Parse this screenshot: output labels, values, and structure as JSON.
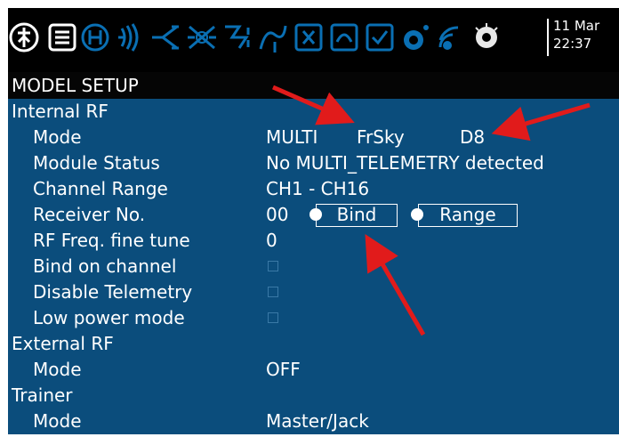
{
  "status_bar": {
    "icons": [
      "radio-menu-icon",
      "model-menu-icon",
      "heli-icon",
      "flight-modes-icon",
      "inputs-icon",
      "mixer-icon",
      "outputs-icon",
      "curves-icon",
      "gvars-icon",
      "logical-switches-icon",
      "special-functions-icon",
      "custom-scripts-icon",
      "telemetry-icon",
      "display-icon"
    ],
    "date": "11 Mar",
    "time": "22:37"
  },
  "page_title": "MODEL SETUP",
  "internal_rf": {
    "section_label": "Internal RF",
    "mode_label": "Mode",
    "mode_value": "MULTI",
    "protocol": "FrSky",
    "subtype": "D8",
    "module_status_label": "Module Status",
    "module_status_value": "No MULTI_TELEMETRY detected",
    "channel_range_label": "Channel Range",
    "channel_range_value": "CH1 - CH16",
    "receiver_no_label": "Receiver No.",
    "receiver_no_value": "00",
    "bind_label": "Bind",
    "range_label": "Range",
    "rf_freq_label": "RF Freq. fine tune",
    "rf_freq_value": "0",
    "bind_on_channel_label": "Bind on channel",
    "disable_telemetry_label": "Disable Telemetry",
    "low_power_label": "Low power mode"
  },
  "external_rf": {
    "section_label": "External RF",
    "mode_label": "Mode",
    "mode_value": "OFF"
  },
  "trainer": {
    "section_label": "Trainer",
    "mode_label": "Mode",
    "mode_value": "Master/Jack"
  },
  "colors": {
    "background": "#0b4d7c",
    "header": "#000000",
    "text": "#ffffff",
    "accent_arrow": "#e11b1b"
  }
}
